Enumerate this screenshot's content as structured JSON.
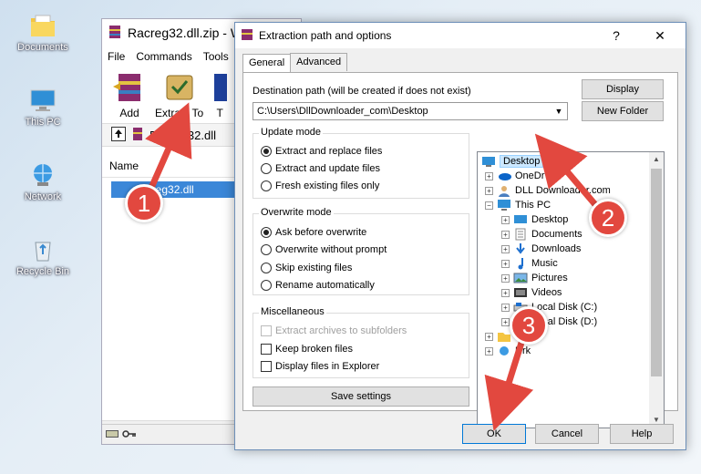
{
  "desktop": {
    "icons": [
      {
        "label": "Documents",
        "icon": "folder-icon"
      },
      {
        "label": "This PC",
        "icon": "computer-icon"
      },
      {
        "label": "Network",
        "icon": "network-icon"
      },
      {
        "label": "Recycle Bin",
        "icon": "recycle-bin-icon"
      }
    ]
  },
  "winrar": {
    "title": "Racreg32.dll.zip - W",
    "menu": [
      "File",
      "Commands",
      "Tools"
    ],
    "toolbar": {
      "add": "Add",
      "extract_to": "Extract To",
      "partial": "T"
    },
    "address": "Racreg32.dll",
    "column_name": "Name",
    "file": "racreg32.dll"
  },
  "dialog": {
    "title": "Extraction path and options",
    "help_btn": "?",
    "close_btn": "✕",
    "tabs": [
      "General",
      "Advanced"
    ],
    "dest_label": "Destination path (will be created if does not exist)",
    "dest_value": "C:\\Users\\DllDownloader_com\\Desktop",
    "display_btn": "Display",
    "new_folder_btn": "New Folder",
    "update_mode": {
      "title": "Update mode",
      "options": [
        "Extract and replace files",
        "Extract and update files",
        "Fresh existing files only"
      ],
      "selected": 0
    },
    "overwrite_mode": {
      "title": "Overwrite mode",
      "options": [
        "Ask before overwrite",
        "Overwrite without prompt",
        "Skip existing files",
        "Rename automatically"
      ],
      "selected": 0
    },
    "misc": {
      "title": "Miscellaneous",
      "options": [
        "Extract archives to subfolders",
        "Keep broken files",
        "Display files in Explorer"
      ]
    },
    "save_btn": "Save settings",
    "tree": [
      {
        "label": "Desktop",
        "level": 0,
        "selected": true,
        "icon": "desktop-icon"
      },
      {
        "label": "OneDr",
        "level": 1,
        "icon": "onedrive-icon"
      },
      {
        "label": "DLL Dow",
        "label2": "nloader.com",
        "level": 1,
        "icon": "user-icon"
      },
      {
        "label": "This PC",
        "level": 1,
        "icon": "computer-icon",
        "expanded": true
      },
      {
        "label": "Desktop",
        "level": 2,
        "icon": "desktop-icon"
      },
      {
        "label": "Documents",
        "level": 2,
        "icon": "documents-icon"
      },
      {
        "label": "Downloads",
        "level": 2,
        "icon": "downloads-icon"
      },
      {
        "label": "Music",
        "level": 2,
        "icon": "music-icon"
      },
      {
        "label": "Pictures",
        "level": 2,
        "icon": "pictures-icon"
      },
      {
        "label": "Videos",
        "level": 2,
        "icon": "videos-icon"
      },
      {
        "label": "Local Disk (C:)",
        "level": 2,
        "icon": "disk-icon"
      },
      {
        "label": "Local Disk (D:)",
        "level": 2,
        "icon": "disk-icon"
      },
      {
        "label": "L",
        "label2": "aries",
        "level": 1,
        "icon": "libraries-icon"
      },
      {
        "label": "N",
        "label2": "rk",
        "level": 1,
        "icon": "network-icon"
      }
    ],
    "ok_btn": "OK",
    "cancel_btn": "Cancel",
    "help_text_btn": "Help"
  },
  "annotations": [
    "1",
    "2",
    "3"
  ],
  "colors": {
    "badge": "#e2483f",
    "accent": "#0078d7",
    "selection": "#cce8ff"
  }
}
